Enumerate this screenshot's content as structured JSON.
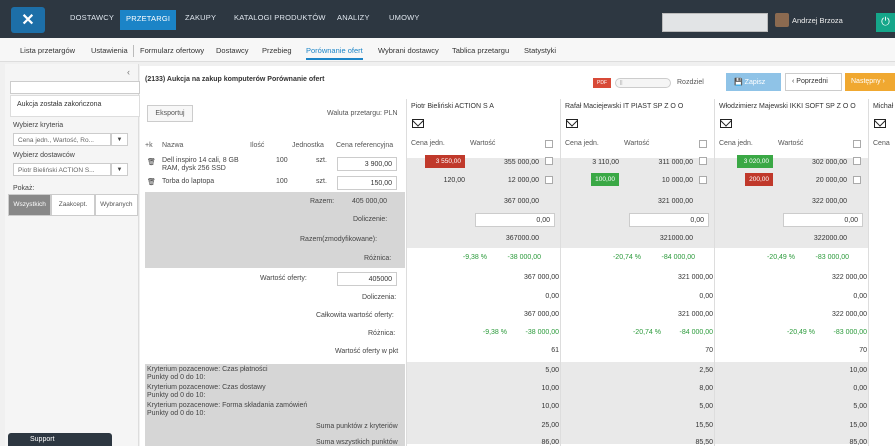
{
  "nav": {
    "items": [
      "DOSTAWCY",
      "PRZETARGI",
      "ZAKUPY",
      "KATALOGI PRODUKTÓW",
      "ANALIZY",
      "UMOWY"
    ],
    "active_index": 1,
    "user": "Andrzej Brzoza"
  },
  "subnav": {
    "items": [
      "Lista przetargów",
      "Ustawienia",
      "Formularz ofertowy",
      "Dostawcy",
      "Przebieg",
      "Porównanie ofert",
      "Wybrani dostawcy",
      "Tablica przetargu",
      "Statystyki"
    ],
    "active_index": 5
  },
  "sidebar": {
    "closed_msg": "Aukcja została zakończona",
    "criteria_label": "Wybierz kryteria",
    "criteria_value": "Cena jedn., Wartość, Ro...",
    "vendors_label": "Wybierz dostawców",
    "vendors_value": "Piotr Bieliński ACTION S...",
    "show_label": "Pokaż:",
    "show_tabs": [
      "Wszystkich",
      "Zaakcept.",
      "Wybranych"
    ],
    "support": "Support"
  },
  "main": {
    "title": "(2133) Aukcja na zakup komputerów Porównanie ofert",
    "pdf": "PDF",
    "split": "Rozdziel",
    "save": "Zapisz",
    "prev": "Poprzedni",
    "next": "Następny",
    "export": "Eksportuj",
    "currency": "Waluta przetargu: PLN"
  },
  "table": {
    "headers": [
      "+k",
      "Nazwa",
      "Ilość",
      "Jednostka",
      "Cena referencyjna"
    ],
    "rows": [
      {
        "name": "Dell inspiro 14 cali, 8 GB RAM, dysk 256 SSD",
        "qty": "100",
        "unit": "szt.",
        "ref": "3 900,00"
      },
      {
        "name": "Torba do laptopa",
        "qty": "100",
        "unit": "szt.",
        "ref": "150,00"
      }
    ],
    "razem_label": "Razem:",
    "razem_value": "405 000,00",
    "dolicz_label": "Doliczenie:",
    "razem_mod_label": "Razem(zmodyfikowane):",
    "roznica_label": "Różnica:",
    "wartosc_label": "Wartość oferty:",
    "wartosc_value": "405000",
    "doliczenia_label": "Doliczenia:",
    "calk_label": "Całkowita wartość oferty:",
    "roznica2_label": "Różnica:",
    "pkt_label": "Wartość oferty w pkt",
    "kryt": [
      "Kryterium pozacenowe: Czas płatności\nPunkty od 0 do 10:",
      "Kryterium pozacenowe: Czas dostawy\nPunkty od 0 do 10:",
      "Kryterium pozacenowe: Forma składania zamówień\nPunkty od 0 do 10:"
    ],
    "suma_kryt": "Suma punktów z kryteriów",
    "suma_all": "Suma wszystkich punktów"
  },
  "vendors": [
    {
      "name": "Piotr Bieliński ACTION S A",
      "h1": "Cena jedn.",
      "h2": "Wartość",
      "p1": "3 550,00",
      "p1color": "#c0392b",
      "v1": "355 000,00",
      "p2": "120,00",
      "p2color": "",
      "v2": "12 000,00",
      "razem": "367 000,00",
      "dolicz": "0,00",
      "razem_mod": "367000.00",
      "diff_pct": "-9,38 %",
      "diff_val": "-38 000,00",
      "wartosc": "367 000,00",
      "dolicz2": "0,00",
      "calk": "367 000,00",
      "diff2_pct": "-9,38 %",
      "diff2_val": "-38 000,00",
      "pkt": "61",
      "k1": "5,00",
      "k2": "10,00",
      "k3": "10,00",
      "suma": "25,00",
      "suma_all": "86,00"
    },
    {
      "name": "Rafał Maciejewski IT PIAST SP Z O O",
      "h1": "Cena jedn.",
      "h2": "Wartość",
      "p1": "3 110,00",
      "p1color": "",
      "v1": "311 000,00",
      "p2": "100,00",
      "p2color": "#3aa845",
      "v2": "10 000,00",
      "razem": "321 000,00",
      "dolicz": "0,00",
      "razem_mod": "321000.00",
      "diff_pct": "-20,74 %",
      "diff_val": "-84 000,00",
      "wartosc": "321 000,00",
      "dolicz2": "0,00",
      "calk": "321 000,00",
      "diff2_pct": "-20,74 %",
      "diff2_val": "-84 000,00",
      "pkt": "70",
      "k1": "2,50",
      "k2": "8,00",
      "k3": "5,00",
      "suma": "15,50",
      "suma_all": "85,50"
    },
    {
      "name": "Włodzimierz Majewski IKKI SOFT SP Z O O",
      "h1": "Cena jedn.",
      "h2": "Wartość",
      "p1": "3 020,00",
      "p1color": "#3aa845",
      "v1": "302 000,00",
      "p2": "200,00",
      "p2color": "#c0392b",
      "v2": "20 000,00",
      "razem": "322 000,00",
      "dolicz": "0,00",
      "razem_mod": "322000.00",
      "diff_pct": "-20,49 %",
      "diff_val": "-83 000,00",
      "wartosc": "322 000,00",
      "dolicz2": "0,00",
      "calk": "322 000,00",
      "diff2_pct": "-20,49 %",
      "diff2_val": "-83 000,00",
      "pkt": "70",
      "k1": "10,00",
      "k2": "0,00",
      "k3": "5,00",
      "suma": "15,00",
      "suma_all": "85,00"
    },
    {
      "name": "Michał",
      "h1": "Cena",
      "h2": ""
    }
  ]
}
